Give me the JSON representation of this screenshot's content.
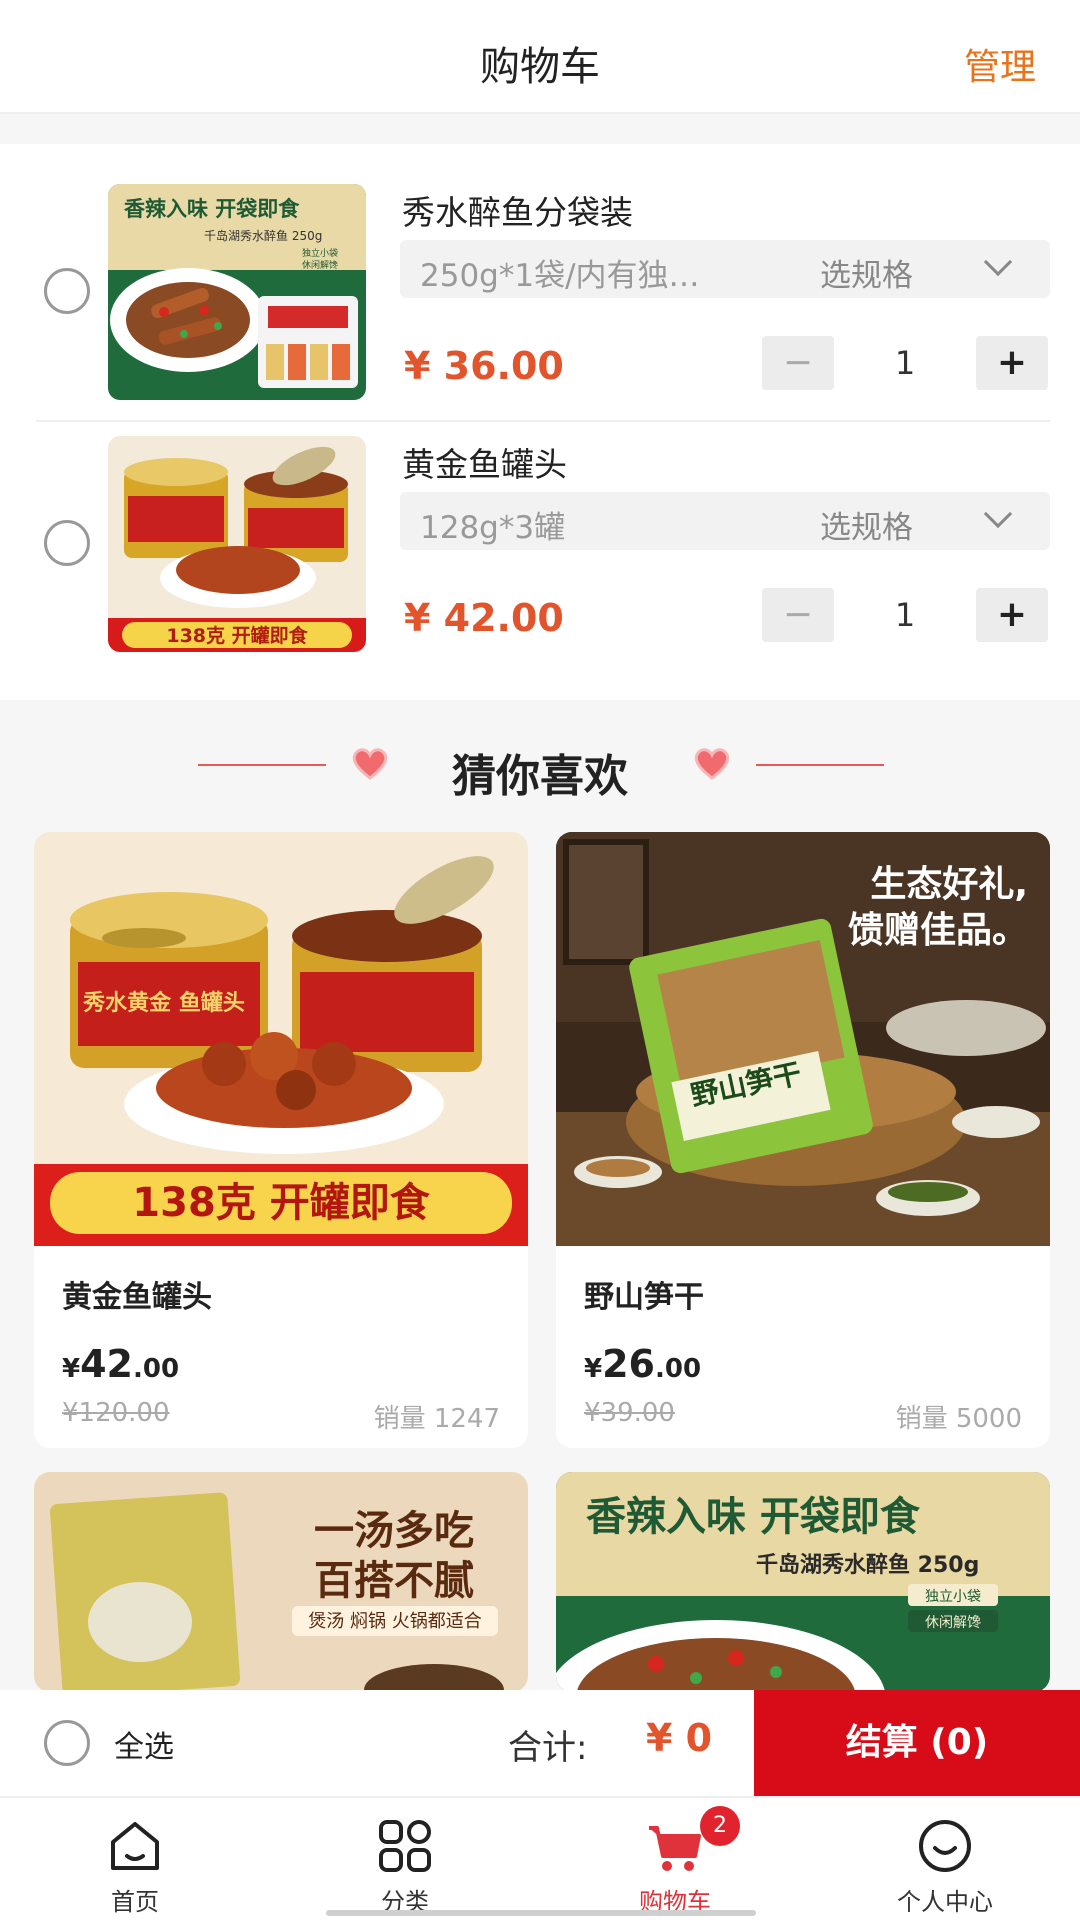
{
  "header": {
    "title": "购物车",
    "manage": "管理"
  },
  "cart": {
    "items": [
      {
        "name": "秀水醉鱼分袋装",
        "spec": "250g*1袋/内有独…",
        "spec_choose": "选规格",
        "price": "¥ 36.00",
        "qty": "1",
        "image": {
          "line1": "香辣入味 开袋即食",
          "line2": "千岛湖秀水醉鱼 250g",
          "tag1": "独立小袋",
          "tag2": "休闲解馋"
        }
      },
      {
        "name": "黄金鱼罐头",
        "spec": "128g*3罐",
        "spec_choose": "选规格",
        "price": "¥ 42.00",
        "qty": "1",
        "image": {
          "banner": "138克 开罐即食"
        }
      }
    ],
    "minus": "−",
    "plus": "+"
  },
  "guess": {
    "title": "猜你喜欢"
  },
  "products": [
    {
      "name": "黄金鱼罐头",
      "price_symbol": "¥",
      "price_int": "42",
      "price_dec": ".00",
      "orig": "¥120.00",
      "sales": "销量 1247",
      "image": {
        "can_label": "秀水黄金 鱼罐头",
        "banner": "138克 开罐即食"
      }
    },
    {
      "name": "野山笋干",
      "price_symbol": "¥",
      "price_int": "26",
      "price_dec": ".00",
      "orig": "¥39.00",
      "sales": "销量 5000",
      "image": {
        "slogan1": "生态好礼,",
        "slogan2": "馈赠佳品。",
        "bag_label": "野山笋干"
      }
    },
    {
      "image": {
        "line1": "一汤多吃",
        "line2": "百搭不腻",
        "line3": "煲汤 焖锅 火锅都适合"
      }
    },
    {
      "image": {
        "line1": "香辣入味 开袋即食",
        "line2": "千岛湖秀水醉鱼 250g",
        "tag1": "独立小袋",
        "tag2": "休闲解馋"
      }
    }
  ],
  "checkout": {
    "select_all": "全选",
    "total_label": "合计:",
    "total_value": "¥ 0",
    "pay": "结算 (0)"
  },
  "tabbar": {
    "tabs": [
      {
        "label": "首页",
        "icon": "home-icon"
      },
      {
        "label": "分类",
        "icon": "category-icon"
      },
      {
        "label": "购物车",
        "icon": "cart-icon",
        "badge": "2"
      },
      {
        "label": "个人中心",
        "icon": "profile-icon"
      }
    ]
  },
  "colors": {
    "accent": "#e2542b",
    "pay": "#d80c18",
    "manage": "#e8731a",
    "active_tab": "#e0323a"
  }
}
